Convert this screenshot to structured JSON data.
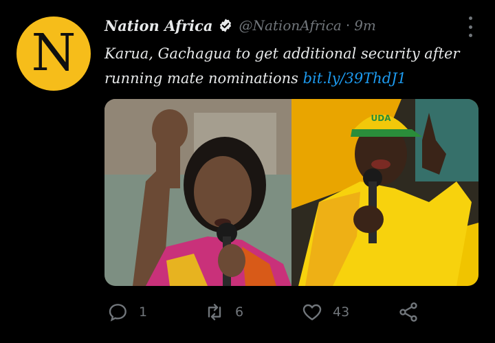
{
  "account": {
    "avatar_letter": "N",
    "name": "Nation Africa",
    "handle": "@NationAfrica",
    "separator": "·",
    "time": "9m"
  },
  "tweet": {
    "text": "Karua, Gachagua to get additional security after running mate nominations ",
    "link": "bit.ly/39ThdJ1"
  },
  "media": {
    "left_photo_caption_on_cap": "",
    "right_cap_text": "UDA"
  },
  "actions": {
    "reply_count": "1",
    "retweet_count": "6",
    "like_count": "43"
  },
  "icons": {
    "verified": "verified-badge-icon",
    "more": "more-options-icon",
    "reply": "reply-icon",
    "retweet": "retweet-icon",
    "like": "heart-icon",
    "share": "share-icon"
  },
  "colors": {
    "background": "#000000",
    "avatar_bg": "#f6bd1a",
    "link": "#1d9bf0",
    "muted": "#71767b"
  }
}
